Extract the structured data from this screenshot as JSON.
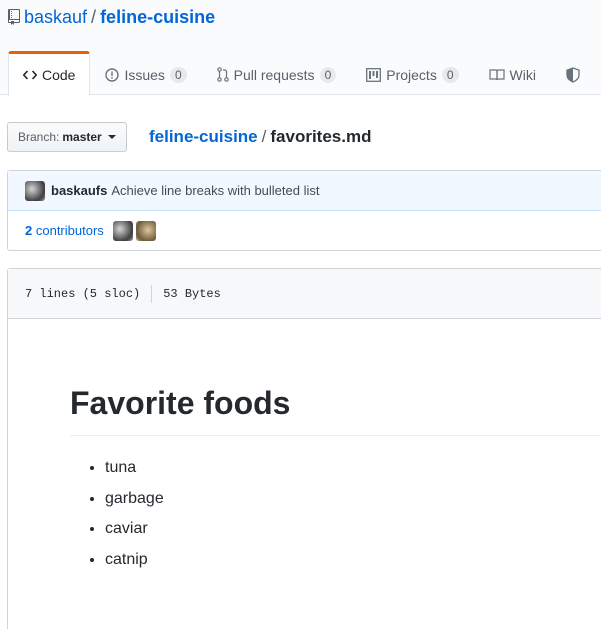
{
  "repo": {
    "owner": "baskauf",
    "separator": "/",
    "name": "feline-cuisine"
  },
  "tabs": [
    {
      "label": "Code",
      "icon": "code-icon",
      "selected": true
    },
    {
      "label": "Issues",
      "icon": "issue-icon",
      "count": "0"
    },
    {
      "label": "Pull requests",
      "icon": "pull-request-icon",
      "count": "0"
    },
    {
      "label": "Projects",
      "icon": "project-icon",
      "count": "0"
    },
    {
      "label": "Wiki",
      "icon": "book-icon"
    },
    {
      "label": "",
      "icon": "shield-icon"
    }
  ],
  "branch": {
    "label": "Branch:",
    "value": "master"
  },
  "breadcrumb": {
    "repo": "feline-cuisine",
    "separator": "/",
    "file": "favorites.md"
  },
  "commit": {
    "author": "baskaufs",
    "message": "Achieve line breaks with bulleted list",
    "contributors_count": "2",
    "contributors_label": "contributors"
  },
  "file_info": {
    "lines": "7 lines (5 sloc)",
    "size": "53 Bytes"
  },
  "content": {
    "heading": "Favorite foods",
    "items": [
      "tuna",
      "garbage",
      "caviar",
      "catnip"
    ]
  },
  "colors": {
    "link": "#0366d6",
    "tab_accent": "#e36209",
    "commit_bg": "#f1f8ff"
  }
}
